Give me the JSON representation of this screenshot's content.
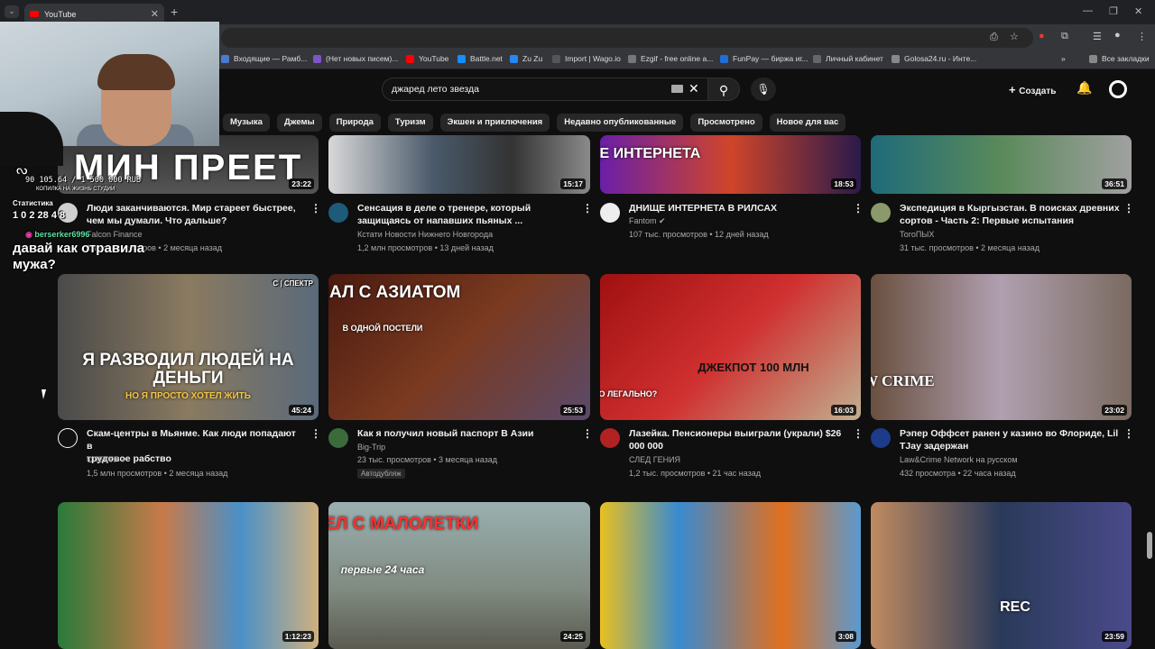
{
  "browser": {
    "tab_title": "YouTube",
    "bookmarks": [
      "Входящие — Рамб...",
      "(Нет новых писем)...",
      "YouTube",
      "Battle.net",
      "Zu Zu",
      "Import | Wago.io",
      "Ezgif - free online a...",
      "FunPay — биржа иг...",
      "Личный кабинет",
      "Golosa24.ru - Инте..."
    ],
    "all_bookmarks": "Все закладки"
  },
  "youtube": {
    "search_value": "джаред лето звезда",
    "create_label": "Создать",
    "chips": [
      "Музыка",
      "Джемы",
      "Природа",
      "Туризм",
      "Экшен и приключения",
      "Недавно опубликованные",
      "Просмотрено",
      "Новое для вас"
    ]
  },
  "videos": [
    {
      "thumb_text": "МИН ПРЕЕТ",
      "duration": "23:22",
      "title1": "Люди заканчиваются. Мир стареет быстрее,",
      "title2": "чем мы думали. Что дальше?",
      "channel": "Falcon Finance",
      "views": "1 тыс. просмотров",
      "age": "2 месяца назад",
      "meta": "",
      "avatar_color": "#d0d0d0"
    },
    {
      "thumb_text": "",
      "duration": "15:17",
      "title1": "Сенсация в деле о тренере, который",
      "title2": "защищаясь от напавших пьяных ...",
      "channel": "Кстати Новости Нижнего Новгорода",
      "meta": "1,2 млн просмотров • 13 дней назад",
      "avatar_color": "#1e5a7a"
    },
    {
      "thumb_text": "ДНИЩЕ ИНТЕРНЕТА",
      "duration": "18:53",
      "title1": "ДНИЩЕ ИНТЕРНЕТА В РИЛСАХ",
      "title2": "",
      "channel": "Fantom",
      "meta": "107 тыс. просмотров • 12 дней назад",
      "avatar_color": "#eeeeee"
    },
    {
      "thumb_text": "",
      "duration": "36:51",
      "title1": "Экспедиция в Кыргызстан. В поисках древних",
      "title2": "сортов - Часть 2: Первые испытания",
      "channel": "ТогоПЫХ",
      "meta": "31 тыс. просмотров • 2 месяца назад",
      "avatar_color": "#8a9a6a"
    },
    {
      "thumb_text": "Я РАЗВОДИЛ ЛЮДЕЙ НА ДЕНЬГИ",
      "thumb_sub": "НО Я ПРОСТО ХОТЕЛ ЖИТЬ",
      "corner": "С | СПЕКТР",
      "duration": "45:24",
      "title1": "Скам-центры в Мьянме. Как люди попадают в",
      "title2": "трудовое рабство",
      "channel": "СПЕКТР",
      "meta": "1,5 млн просмотров • 2 месяца назад",
      "avatar_color": "#111111"
    },
    {
      "thumb_text": "СПАЛ С АЗИАТОМ",
      "thumb_sub": "В ОДНОЙ ПОСТЕЛИ",
      "duration": "25:53",
      "title1": "Как я получил новый паспорт В Азии",
      "title2": "",
      "channel": "Big-Trip",
      "meta": "23 тыс. просмотров • 3 месяца назад",
      "dub": "Автодубляж",
      "avatar_color": "#3b6a3b"
    },
    {
      "thumb_text": "ДЖЕКПОТ 100 МЛН",
      "thumb_sub": "ЭТО ЛЕГАЛЬНО?",
      "duration": "16:03",
      "title1": "Лазейка. Пенсионеры выиграли (украли) $26",
      "title2": "000 000",
      "channel": "СЛЕД ГЕНИЯ",
      "meta": "1,2 тыс. просмотров • 21 час назад",
      "avatar_color": "#b22222"
    },
    {
      "thumb_text": "LAW CRIME",
      "duration": "23:02",
      "title1": "Рэпер Оффсет ранен у казино во Флориде, Lil",
      "title2": "TJay задержан",
      "channel": "Law&Crime Network на русском",
      "meta": "432 просмотра • 22 часа назад",
      "avatar_color": "#1e3a8a"
    },
    {
      "thumb_text": "",
      "duration": "1:12:23",
      "title1": "",
      "title2": "",
      "channel": "",
      "meta": "",
      "avatar_color": "#444"
    },
    {
      "thumb_text": "ВЫШЕЛ С МАЛОЛЕТКИ",
      "thumb_sub": "первые 24 часа",
      "duration": "24:25",
      "title1": "",
      "title2": "",
      "channel": "",
      "meta": "",
      "avatar_color": "#444"
    },
    {
      "thumb_text": "",
      "duration": "3:08",
      "title1": "",
      "title2": "",
      "channel": "",
      "meta": "",
      "avatar_color": "#444"
    },
    {
      "thumb_text": "REC",
      "duration": "23:59",
      "title1": "",
      "title2": "",
      "channel": "",
      "meta": "",
      "avatar_color": "#444"
    }
  ],
  "overlay": {
    "goal_text": "90 105.64 / 1 500 000 RUB",
    "goal_sub": "КОПИЛКА НА ЖИЗНЬ СТУДИИ",
    "stats_label": "Статистика",
    "counts": "1 0 2 28 4 8",
    "user": "berserker6996",
    "message": "давай как отравила мужа?"
  }
}
